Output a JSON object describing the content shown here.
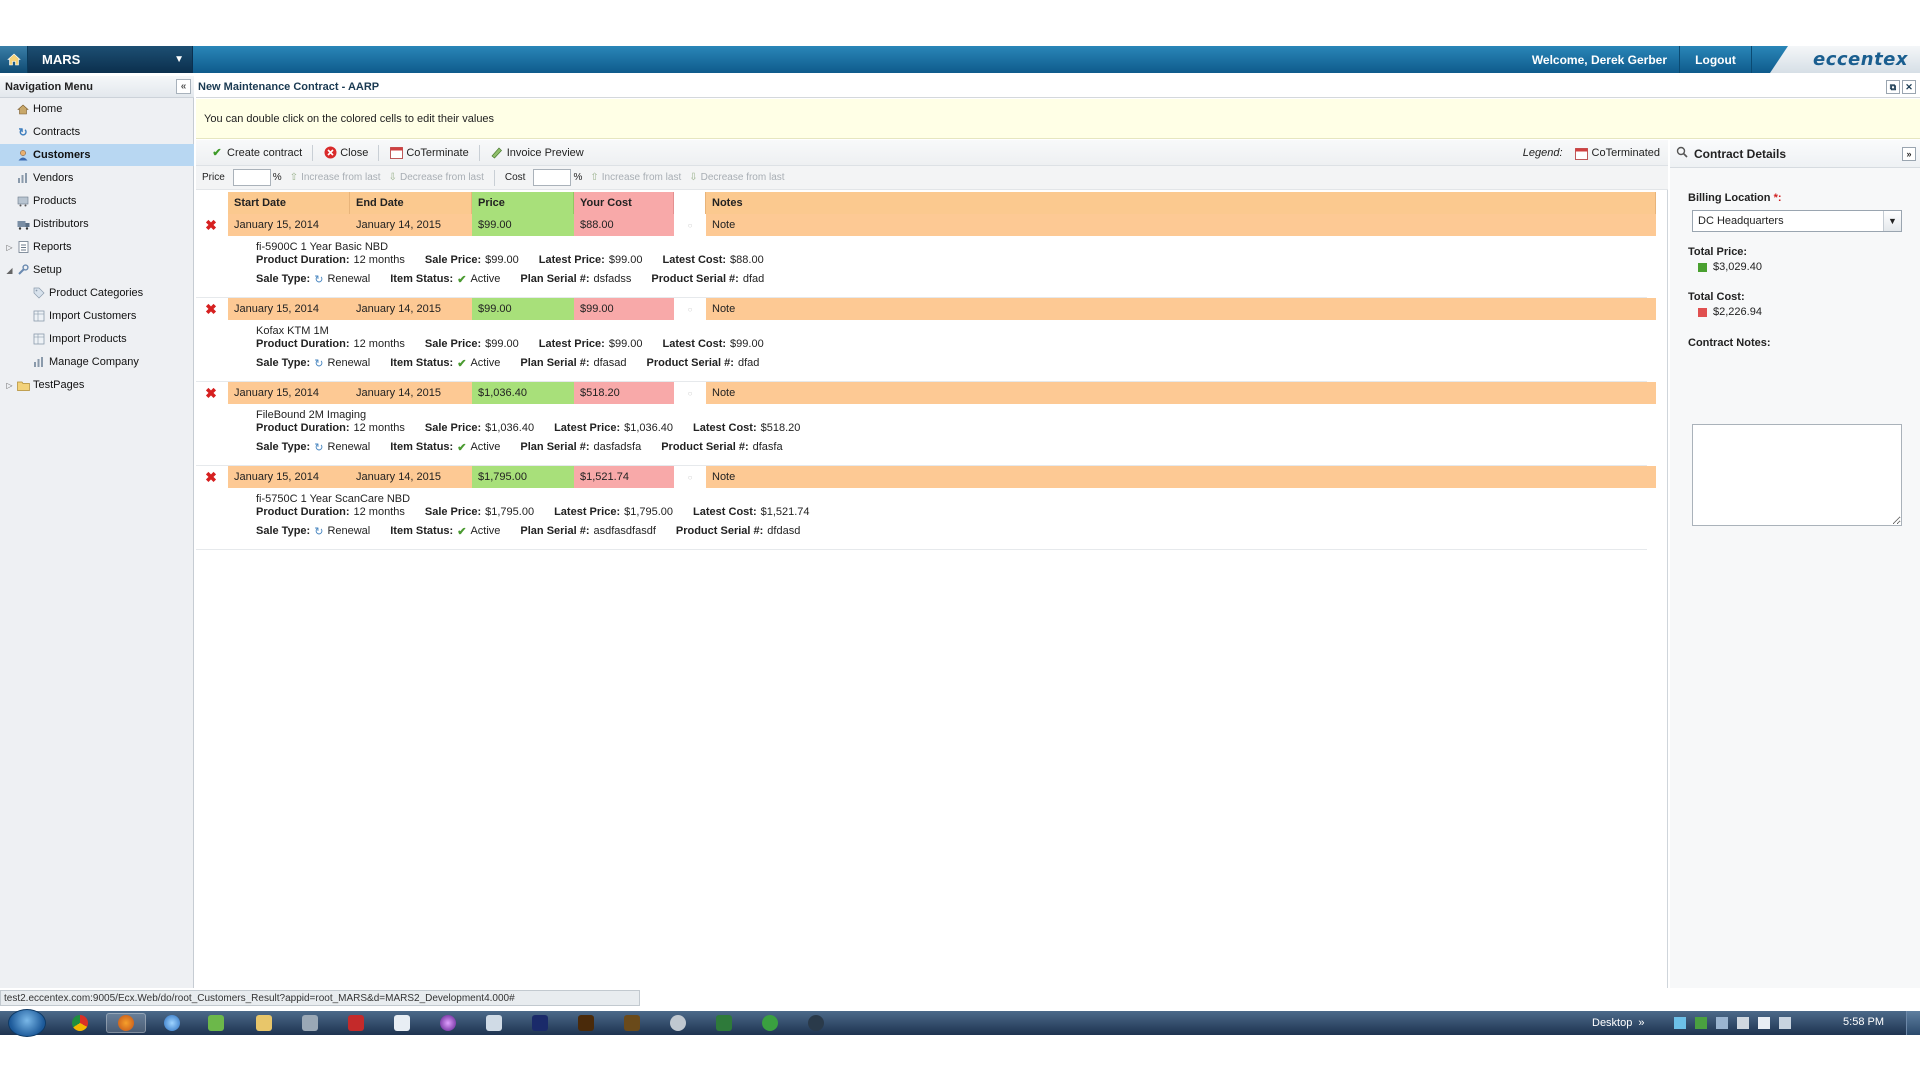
{
  "header": {
    "app_name": "MARS",
    "welcome": "Welcome, Derek Gerber",
    "logout": "Logout",
    "logo": "eccentex"
  },
  "sidebar": {
    "title": "Navigation Menu",
    "items": [
      {
        "label": "Home",
        "icon": "house-icon"
      },
      {
        "label": "Contracts",
        "icon": "renew-icon"
      },
      {
        "label": "Customers",
        "icon": "user-icon",
        "selected": true
      },
      {
        "label": "Vendors",
        "icon": "chart-icon"
      },
      {
        "label": "Products",
        "icon": "cart-icon"
      },
      {
        "label": "Distributors",
        "icon": "truck-icon"
      },
      {
        "label": "Reports",
        "icon": "report-icon"
      },
      {
        "label": "Setup",
        "icon": "wrench-icon"
      },
      {
        "label": "Product Categories",
        "icon": "tag-icon"
      },
      {
        "label": "Import Customers",
        "icon": "import-icon"
      },
      {
        "label": "Import Products",
        "icon": "import-icon"
      },
      {
        "label": "Manage Company",
        "icon": "chart-icon"
      },
      {
        "label": "TestPages",
        "icon": "folder-icon"
      }
    ]
  },
  "main": {
    "tab_title": "New Maintenance Contract - AARP",
    "hint": "You can double click on the colored cells to edit their values",
    "toolbar": {
      "create": "Create contract",
      "close": "Close",
      "coterminate": "CoTerminate",
      "invoice": "Invoice Preview",
      "legend_label": "Legend:",
      "legend_item": "CoTerminated"
    },
    "adjust": {
      "price_label": "Price",
      "cost_label": "Cost",
      "pct": "%",
      "increase": "Increase from last",
      "decrease": "Decrease from last"
    },
    "grid": {
      "columns": [
        "Start Date",
        "End Date",
        "Price",
        "Your Cost",
        "",
        "Notes"
      ],
      "labels": {
        "duration": "Product Duration:",
        "sale_price": "Sale Price:",
        "latest_price": "Latest Price:",
        "latest_cost": "Latest Cost:",
        "sale_type": "Sale Type:",
        "item_status": "Item Status:",
        "plan_serial": "Plan Serial #:",
        "product_serial": "Product Serial #:"
      },
      "rows": [
        {
          "start": "January 15, 2014",
          "end": "January 14, 2015",
          "price": "$99.00",
          "cost": "$88.00",
          "note": "Note",
          "product": "fi-5900C 1 Year Basic NBD",
          "duration": "12 months",
          "sale_price": "$99.00",
          "latest_price": "$99.00",
          "latest_cost": "$88.00",
          "sale_type": "Renewal",
          "status": "Active",
          "plan_serial": "dsfadss",
          "product_serial": "dfad"
        },
        {
          "start": "January 15, 2014",
          "end": "January 14, 2015",
          "price": "$99.00",
          "cost": "$99.00",
          "note": "Note",
          "product": "Kofax KTM 1M",
          "duration": "12 months",
          "sale_price": "$99.00",
          "latest_price": "$99.00",
          "latest_cost": "$99.00",
          "sale_type": "Renewal",
          "status": "Active",
          "plan_serial": "dfasad",
          "product_serial": "dfad"
        },
        {
          "start": "January 15, 2014",
          "end": "January 14, 2015",
          "price": "$1,036.40",
          "cost": "$518.20",
          "note": "Note",
          "product": "FileBound 2M Imaging",
          "duration": "12 months",
          "sale_price": "$1,036.40",
          "latest_price": "$1,036.40",
          "latest_cost": "$518.20",
          "sale_type": "Renewal",
          "status": "Active",
          "plan_serial": "dasfadsfa",
          "product_serial": "dfasfa"
        },
        {
          "start": "January 15, 2014",
          "end": "January 14, 2015",
          "price": "$1,795.00",
          "cost": "$1,521.74",
          "note": "Note",
          "product": "fi-5750C 1 Year ScanCare NBD",
          "duration": "12 months",
          "sale_price": "$1,795.00",
          "latest_price": "$1,795.00",
          "latest_cost": "$1,521.74",
          "sale_type": "Renewal",
          "status": "Active",
          "plan_serial": "asdfasdfasdf",
          "product_serial": "dfdasd"
        }
      ]
    }
  },
  "details": {
    "title": "Contract Details",
    "billing_label": "Billing Location",
    "required_mark": "*:",
    "billing_value": "DC Headquarters",
    "total_price_label": "Total Price:",
    "total_price": "$3,029.40",
    "total_cost_label": "Total Cost:",
    "total_cost": "$2,226.94",
    "notes_label": "Contract Notes:"
  },
  "statusbar": "test2.eccentex.com:9005/Ecx.Web/do/root_Customers_Result?appid=root_MARS&d=MARS2_Development4.000#",
  "taskbar": {
    "desktop": "Desktop",
    "desktop_chevron": "»",
    "clock": "5:58 PM"
  },
  "colors": {
    "header": "#1a6fa0",
    "date_cell": "#fdc994",
    "price_cell": "#a8e07a",
    "cost_cell": "#f8a9a9",
    "selected_nav": "#b8d7f2",
    "hint_bg": "#ffffe6"
  }
}
